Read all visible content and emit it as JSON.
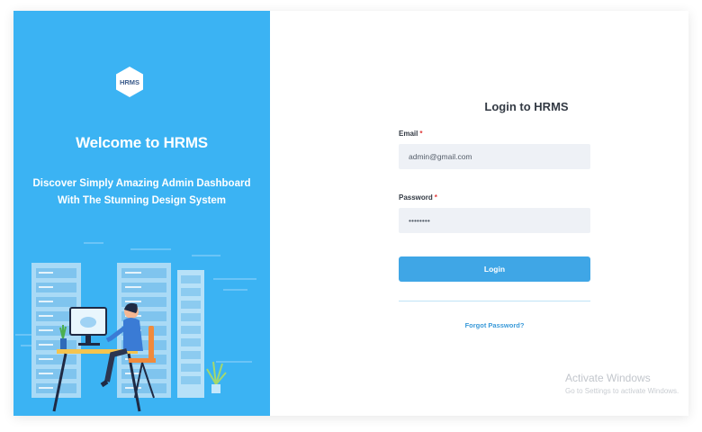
{
  "brand": {
    "logo_text": "HRMS",
    "welcome": "Welcome to HRMS",
    "tagline_line1": "Discover Simply Amazing Admin Dashboard",
    "tagline_line2": "With The Stunning Design System",
    "panel_color": "#3bb3f3"
  },
  "form": {
    "title": "Login to HRMS",
    "email_label": "Email",
    "email_value": "admin@gmail.com",
    "password_label": "Password",
    "password_value": "••••••••",
    "required_mark": "*",
    "login_label": "Login",
    "forgot_label": "Forgot Password?",
    "accent": "#3fa6e6"
  },
  "watermark": {
    "title": "Activate Windows",
    "subtitle": "Go to Settings to activate Windows."
  }
}
